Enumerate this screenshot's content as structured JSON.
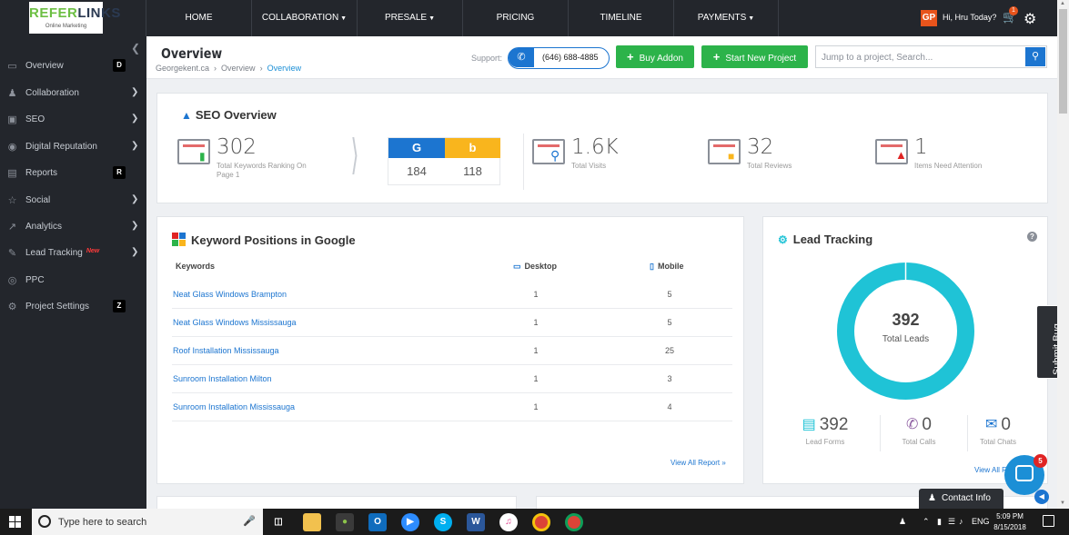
{
  "brand": {
    "name_part1": "REFER",
    "name_part2": "LINKS",
    "tagline": "Online Marketing"
  },
  "nav": [
    {
      "label": "HOME",
      "dropdown": false
    },
    {
      "label": "COLLABORATION",
      "dropdown": true
    },
    {
      "label": "PRESALE",
      "dropdown": true
    },
    {
      "label": "PRICING",
      "dropdown": false
    },
    {
      "label": "TIMELINE",
      "dropdown": false
    },
    {
      "label": "PAYMENTS",
      "dropdown": true
    }
  ],
  "user": {
    "initials": "GP",
    "greeting": "Hi, Hru Today?",
    "cart_count": "1"
  },
  "sidebar": {
    "items": [
      {
        "label": "Overview",
        "icon": "monitor-icon",
        "shortcut": "D"
      },
      {
        "label": "Collaboration",
        "icon": "users-icon",
        "arrow": true
      },
      {
        "label": "SEO",
        "icon": "seo-icon",
        "arrow": true
      },
      {
        "label": "Digital Reputation",
        "icon": "location-icon",
        "arrow": true
      },
      {
        "label": "Reports",
        "icon": "reports-icon",
        "shortcut": "R"
      },
      {
        "label": "Social",
        "icon": "social-icon",
        "arrow": true
      },
      {
        "label": "Analytics",
        "icon": "analytics-icon",
        "arrow": true
      },
      {
        "label": "Lead Tracking",
        "icon": "lead-icon",
        "arrow": true,
        "badge": "New"
      },
      {
        "label": "PPC",
        "icon": "ppc-icon"
      },
      {
        "label": "Project Settings",
        "icon": "settings-icon",
        "shortcut": "Z"
      }
    ]
  },
  "header": {
    "title": "Overview",
    "breadcrumb": [
      "Georgekent.ca",
      "Overview",
      "Overview"
    ],
    "support_label": "Support:",
    "phone": "(646) 688-4885",
    "buy_addon": "Buy Addon",
    "start_project": "Start New Project",
    "search_placeholder": "Jump to a project, Search..."
  },
  "seo_overview": {
    "title": "SEO Overview",
    "keywords_ranking": {
      "value": "302",
      "label": "Total Keywords Ranking On Page 1"
    },
    "google": "184",
    "bing": "118",
    "total_visits": {
      "value": "1.6K",
      "label": "Total Visits"
    },
    "total_reviews": {
      "value": "32",
      "label": "Total Reviews"
    },
    "attention": {
      "value": "1",
      "label": "Items Need Attention"
    }
  },
  "keyword_positions": {
    "title": "Keyword Positions in Google",
    "col_keywords": "Keywords",
    "col_desktop": "Desktop",
    "col_mobile": "Mobile",
    "rows": [
      {
        "keyword": "Neat Glass Windows Brampton",
        "desktop": "1",
        "mobile": "5"
      },
      {
        "keyword": "Neat Glass Windows Mississauga",
        "desktop": "1",
        "mobile": "5"
      },
      {
        "keyword": "Roof Installation Mississauga",
        "desktop": "1",
        "mobile": "25"
      },
      {
        "keyword": "Sunroom Installation Milton",
        "desktop": "1",
        "mobile": "3"
      },
      {
        "keyword": "Sunroom Installation Mississauga",
        "desktop": "1",
        "mobile": "4"
      }
    ],
    "view_all": "View All Report »"
  },
  "lead_tracking": {
    "title": "Lead Tracking",
    "total": "392",
    "total_label": "Total Leads",
    "forms": {
      "value": "392",
      "label": "Lead Forms"
    },
    "calls": {
      "value": "0",
      "label": "Total Calls"
    },
    "chats": {
      "value": "0",
      "label": "Total Chats"
    },
    "view_all": "View All R"
  },
  "floating": {
    "submit_bug": "Submit Bug",
    "chat_badge": "5",
    "contact_info": "Contact Info"
  },
  "taskbar": {
    "search_text": "Type here to search",
    "language": "ENG",
    "time": "5:09 PM",
    "date": "8/15/2018"
  },
  "colors": {
    "accent_blue": "#1c75d0",
    "green": "#2cb34a",
    "donut": "#1fc3d6",
    "sidebar_bg": "#23262c",
    "google_blue": "#1c75d0",
    "bing_yellow": "#f9b51d"
  }
}
